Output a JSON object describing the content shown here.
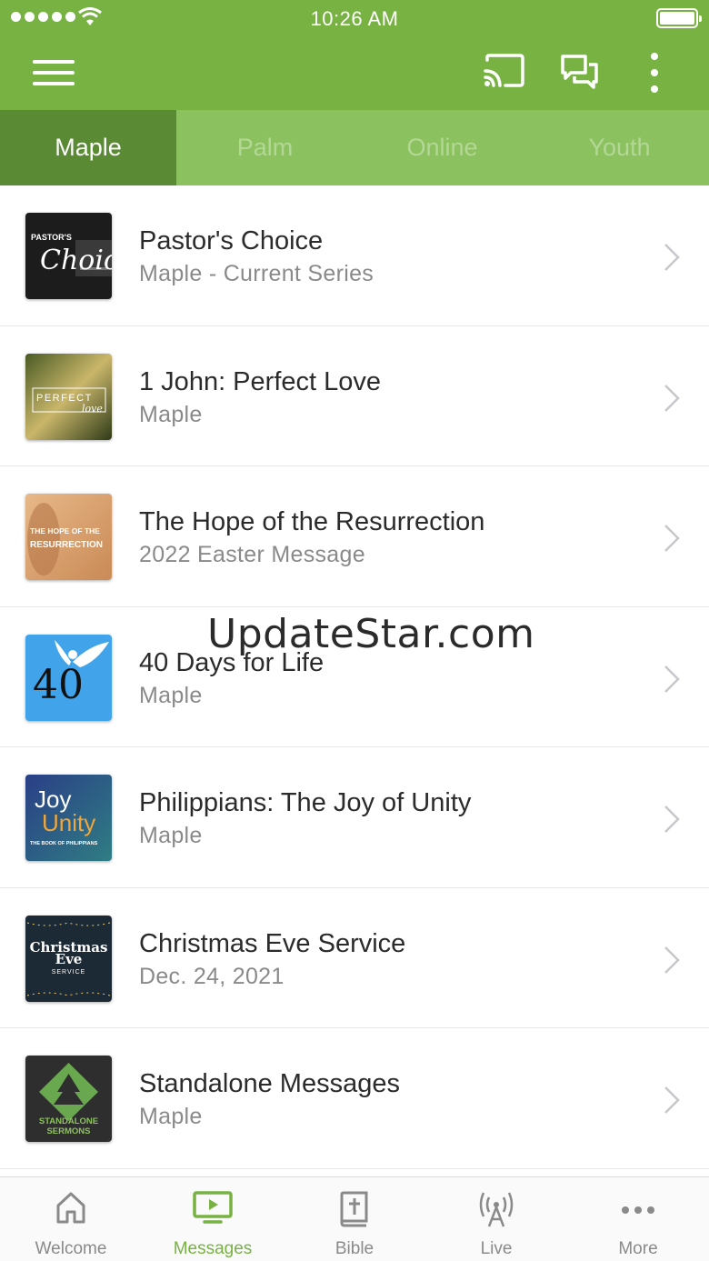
{
  "status_bar": {
    "time": "10:26 AM"
  },
  "app_bar": {
    "icons": [
      "menu-icon",
      "cast-icon",
      "chat-icon",
      "more-vertical-icon"
    ],
    "color": "#77b243"
  },
  "tabs": [
    {
      "label": "Maple",
      "active": true
    },
    {
      "label": "Palm",
      "active": false
    },
    {
      "label": "Online",
      "active": false
    },
    {
      "label": "Youth",
      "active": false
    }
  ],
  "list": [
    {
      "title": "Pastor's Choice",
      "subtitle": "Maple - Current Series",
      "thumb": {
        "line1": "PASTOR'S",
        "line2": "Choice"
      }
    },
    {
      "title": "1 John: Perfect Love",
      "subtitle": "Maple",
      "thumb": {
        "line1": "PERFECT",
        "line2": "love"
      }
    },
    {
      "title": "The Hope of the Resurrection",
      "subtitle": "2022 Easter Message",
      "thumb": {
        "line1": "THE HOPE OF THE",
        "line2": "RESURRECTION"
      }
    },
    {
      "title": "40 Days for Life",
      "subtitle": "Maple",
      "thumb": {
        "line1": "40"
      }
    },
    {
      "title": "Philippians: The Joy of Unity",
      "subtitle": "Maple",
      "thumb": {
        "line1": "Joy",
        "line2": "Unity",
        "line3": "THE BOOK OF PHILIPPIANS"
      }
    },
    {
      "title": "Christmas Eve Service",
      "subtitle": "Dec. 24, 2021",
      "thumb": {
        "line1": "Christmas",
        "line2": "Eve",
        "line3": "SERVICE"
      }
    },
    {
      "title": "Standalone Messages",
      "subtitle": "Maple",
      "thumb": {
        "line1": "STANDALONE",
        "line2": "SERMONS"
      }
    }
  ],
  "watermark": "UpdateStar.com",
  "bottom_nav": [
    {
      "label": "Welcome",
      "icon": "home-icon",
      "active": false
    },
    {
      "label": "Messages",
      "icon": "tv-play-icon",
      "active": true
    },
    {
      "label": "Bible",
      "icon": "bible-icon",
      "active": false
    },
    {
      "label": "Live",
      "icon": "broadcast-icon",
      "active": false
    },
    {
      "label": "More",
      "icon": "more-horizontal-icon",
      "active": false
    }
  ],
  "colors": {
    "primary": "#77b243",
    "tab_active": "#5a8a33",
    "tab_bar": "#8cc15f"
  }
}
